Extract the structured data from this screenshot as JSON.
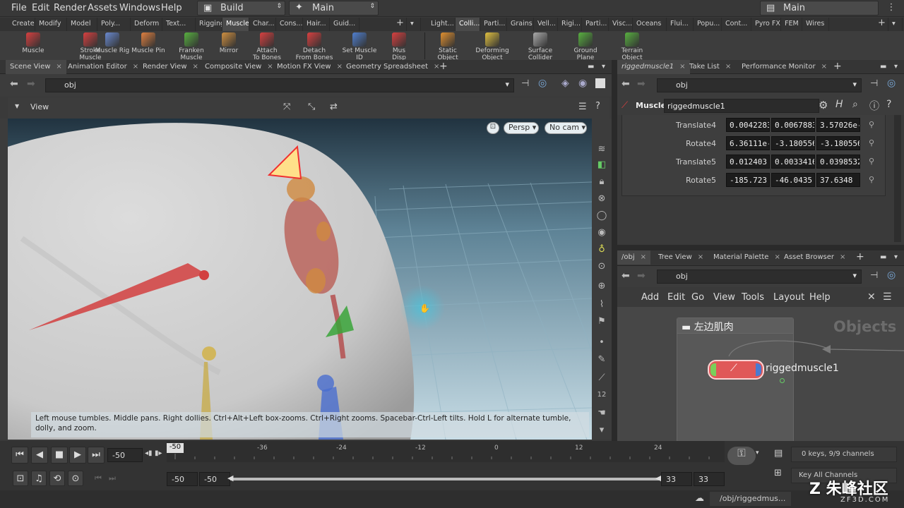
{
  "menubar": {
    "items": [
      "File",
      "Edit",
      "Render",
      "Assets",
      "Windows",
      "Help"
    ],
    "desktop": "Build",
    "context": "Main",
    "right_context": "Main"
  },
  "shelf_tabs_left": [
    "Create",
    "Modify",
    "Model",
    "Poly...",
    "Deform",
    "Text...",
    "Rigging",
    "Muscles",
    "Char...",
    "Cons...",
    "Hair...",
    "Guid..."
  ],
  "shelf_tabs_right": [
    "Light...",
    "Colli...",
    "Parti...",
    "Grains",
    "Vell...",
    "Rigi...",
    "Parti...",
    "Visc...",
    "Oceans",
    "Flui...",
    "Popu...",
    "Cont...",
    "Pyro FX",
    "FEM",
    "Wires"
  ],
  "tools_left": [
    {
      "label": "Muscle",
      "label2": ""
    },
    {
      "label": "Stroke Muscle",
      "label2": ""
    },
    {
      "label": "Muscle Rig",
      "label2": ""
    },
    {
      "label": "Muscle Pin",
      "label2": ""
    },
    {
      "label": "Franken",
      "label2": "Muscle"
    },
    {
      "label": "Mirror",
      "label2": ""
    },
    {
      "label": "Attach",
      "label2": "To Bones"
    },
    {
      "label": "Detach",
      "label2": "From Bones"
    },
    {
      "label": "Set Muscle ID",
      "label2": ""
    },
    {
      "label": "Mus",
      "label2": "Disp"
    }
  ],
  "tools_right": [
    {
      "label": "Static Object",
      "label2": ""
    },
    {
      "label": "Deforming",
      "label2": "Object"
    },
    {
      "label": "Surface",
      "label2": "Collider"
    },
    {
      "label": "Ground Plane",
      "label2": ""
    },
    {
      "label": "Terrain Object",
      "label2": ""
    }
  ],
  "left_tabs": [
    "Scene View",
    "Animation Editor",
    "Render View",
    "Composite View",
    "Motion FX View",
    "Geometry Spreadsheet"
  ],
  "left_path": "obj",
  "view_label": "View",
  "viewport": {
    "persp": "Persp",
    "cam": "No cam",
    "hint": "Left mouse tumbles. Middle pans. Right dollies. Ctrl+Alt+Left box-zooms. Ctrl+Right zooms. Spacebar-Ctrl-Left tilts. Hold L for alternate tumble, dolly, and zoom."
  },
  "right_top_tabs": [
    "riggedmuscle1",
    "Take List",
    "Performance Monitor"
  ],
  "right_top_path": "obj",
  "param_header": {
    "type": "Muscle",
    "name": "riggedmuscle1"
  },
  "params": [
    {
      "label": "Translate4",
      "v": [
        "0.0042283",
        "0.0067883",
        "3.57026e-"
      ]
    },
    {
      "label": "Rotate4",
      "v": [
        "6.36111e-",
        "-3.180556",
        "-3.180556"
      ]
    },
    {
      "label": "Translate5",
      "v": [
        "0.012403",
        "0.0033416",
        "0.0398532"
      ]
    },
    {
      "label": "Rotate5",
      "v": [
        "-185.723",
        "-46.0435",
        "37.6348"
      ]
    }
  ],
  "right_bottom_tabs": [
    "/obj",
    "Tree View",
    "Material Palette",
    "Asset Browser"
  ],
  "right_bottom_path": "obj",
  "network_menu": [
    "Add",
    "Edit",
    "Go",
    "View",
    "Tools",
    "Layout",
    "Help"
  ],
  "network": {
    "box_title": "左边肌肉",
    "node_name": "riggedmuscle1",
    "watermark": "Objects"
  },
  "timeline": {
    "current": "-50",
    "ticks": [
      "-50",
      "-36",
      "-24",
      "-12",
      "0",
      "12",
      "24"
    ],
    "start1": "-50",
    "start2": "-50",
    "end1": "33",
    "end2": "33",
    "keys": "0 keys, 9/9 channels",
    "key_all": "Key All Channels",
    "status_path": "/obj/riggedmus...",
    "brand": "朱峰社区",
    "brand_url": "ZF3D.COM"
  }
}
